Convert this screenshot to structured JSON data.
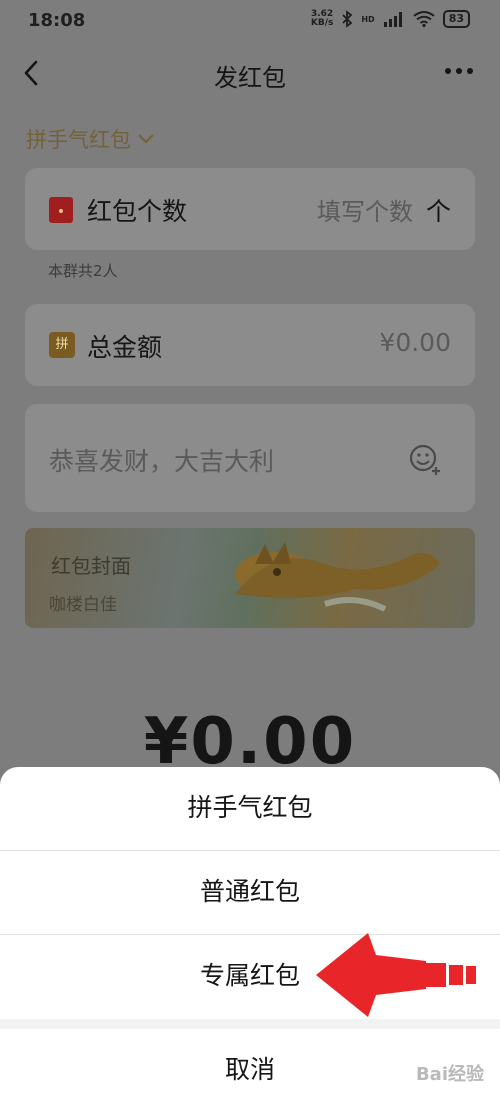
{
  "status_bar": {
    "time": "18:08",
    "net_speed_value": "3.62",
    "net_speed_unit": "KB/s",
    "network": "HD",
    "battery": "83"
  },
  "nav": {
    "title": "发红包"
  },
  "type_selector": {
    "label": "拼手气红包"
  },
  "count_card": {
    "label": "红包个数",
    "placeholder": "填写个数",
    "unit": "个"
  },
  "group_hint": "本群共2人",
  "amount_card": {
    "icon_text": "拼",
    "label": "总金额",
    "value": "¥0.00"
  },
  "message_card": {
    "placeholder": "恭喜发财，大吉大利"
  },
  "cover": {
    "title": "红包封面",
    "subtitle": "咖楼白佳"
  },
  "total_amount": "¥0.00",
  "sheet": {
    "options": [
      "拼手气红包",
      "普通红包",
      "专属红包"
    ],
    "cancel": "取消"
  },
  "watermark": "Bai经验",
  "colors": {
    "arrow": "#e8262a",
    "accent_gold": "#74613a",
    "red_packet": "#a01e1e"
  }
}
